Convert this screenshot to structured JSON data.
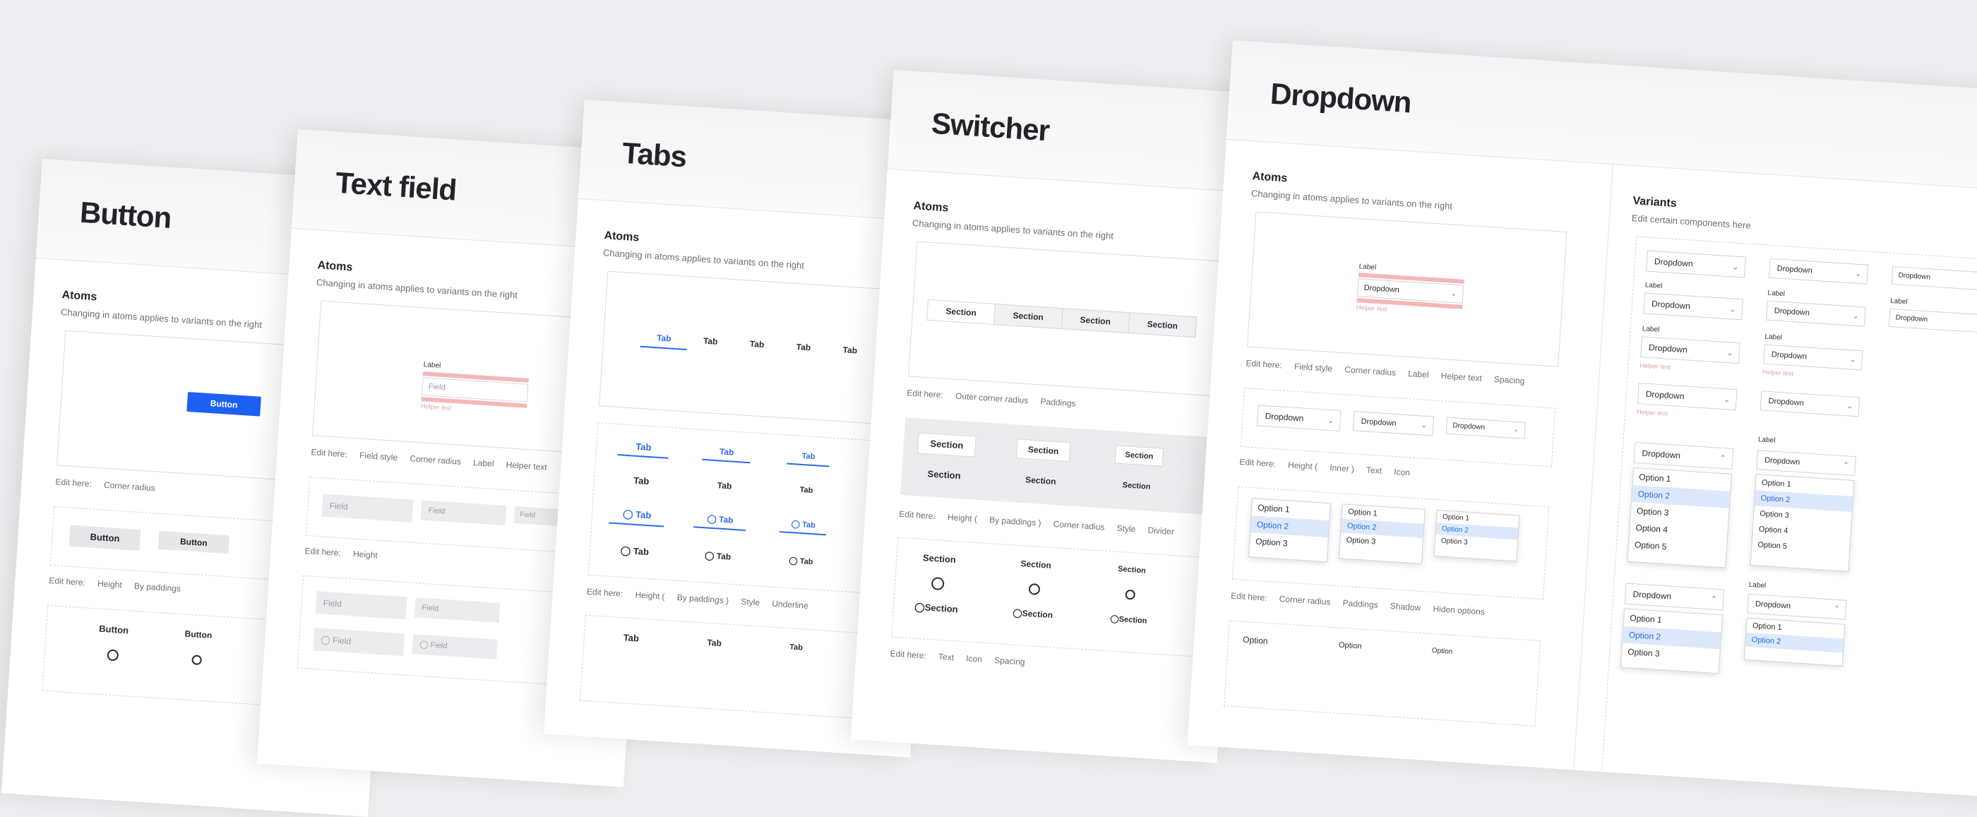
{
  "common": {
    "atoms": "Atoms",
    "atoms_desc": "Changing in atoms applies to variants on the right",
    "edit_here": "Edit here:"
  },
  "button": {
    "title": "Button",
    "label": "Button",
    "edit1": [
      "Corner radius"
    ],
    "edit2": [
      "Height",
      "By paddings"
    ]
  },
  "textfield": {
    "title": "Text field",
    "label": "Label",
    "field": "Field",
    "helper": "Helper text",
    "edit1": [
      "Field style",
      "Corner radius",
      "Label",
      "Helper text"
    ],
    "edit2": [
      "Height"
    ]
  },
  "tabs": {
    "title": "Tabs",
    "tab": "Tab",
    "edit1": [
      "Height (",
      "By paddings )",
      "Style",
      "Underline"
    ]
  },
  "switcher": {
    "title": "Switcher",
    "section": "Section",
    "edit1": [
      "Outer corner radius",
      "Paddings"
    ],
    "edit2": [
      "Height (",
      "By paddings )",
      "Corner radius",
      "Style",
      "Divider"
    ],
    "edit3": [
      "Text",
      "Icon",
      "Spacing"
    ]
  },
  "dropdown": {
    "title": "Dropdown",
    "dropdown": "Dropdown",
    "label": "Label",
    "helper": "Helper text",
    "variants": "Variants",
    "variants_desc": "Edit certain components here",
    "options": [
      "Option 1",
      "Option 2",
      "Option 3",
      "Option 4",
      "Option 5"
    ],
    "option": "Option",
    "edit1": [
      "Field style",
      "Corner radius",
      "Label",
      "Helper text",
      "Spacing"
    ],
    "edit2": [
      "Height (",
      "Inner )",
      "Text",
      "Icon"
    ],
    "edit3": [
      "Corner radius",
      "Paddings",
      "Shadow",
      "Hiden options"
    ]
  }
}
